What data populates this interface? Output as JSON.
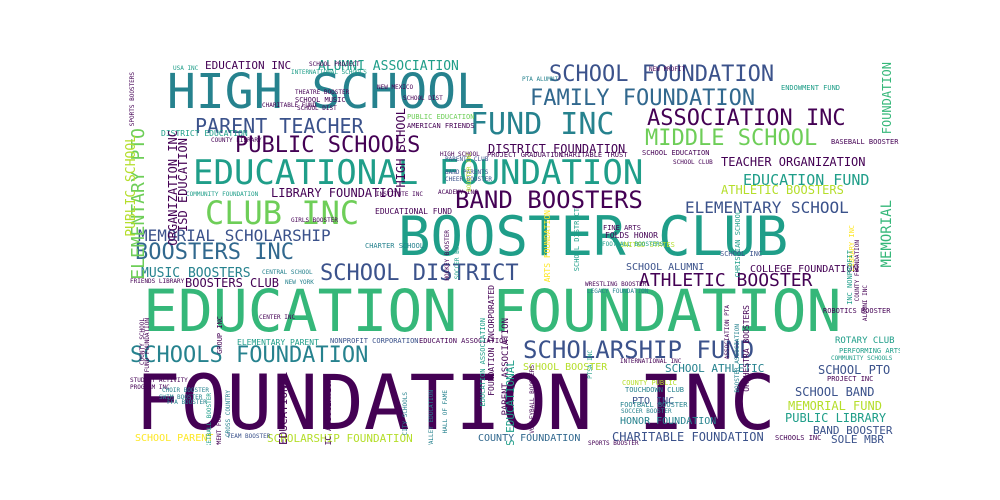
{
  "palette": {
    "dark_purple": "#440154",
    "indigo": "#3b528b",
    "slate_blue": "#31688e",
    "teal_blue": "#26828e",
    "teal": "#1f9e89",
    "green": "#35b779",
    "light_green": "#6ece58",
    "yellow_green": "#b5de2b",
    "yellow": "#fde725"
  },
  "words": {
    "foundation_inc": "FOUNDATION INC",
    "education_foundation": "EDUCATION FOUNDATION",
    "booster_club": "BOOSTER CLUB",
    "high_school": "HIGH SCHOOL",
    "educational_foundation": "EDUCATIONAL FOUNDATION",
    "school_foundation": "SCHOOL FOUNDATION",
    "family_foundation": "FAMILY FOUNDATION",
    "fund_inc": "FUND INC",
    "association_inc": "ASSOCIATION INC",
    "middle_school": "MIDDLE SCHOOL",
    "parent_teacher": "PARENT TEACHER",
    "public_schools": "PUBLIC SCHOOLS",
    "club_inc": "CLUB INC",
    "band_boosters": "BAND BOOSTERS",
    "elementary_school": "ELEMENTARY SCHOOL",
    "memorial_scholarship": "MEMORIAL SCHOLARSHIP",
    "boosters_inc": "BOOSTERS INC",
    "school_district": "SCHOOL DISTRICT",
    "athletic_booster": "ATHLETIC BOOSTER",
    "schools_foundation": "SCHOOLS FOUNDATION",
    "scholarship_fund": "SCHOLARSHIP FUND",
    "education_fund": "EDUCATION FUND",
    "alumni_association": "ALUMNI ASSOCIATION",
    "education_inc": "EDUCATION INC",
    "teacher_organization": "TEACHER ORGANIZATION",
    "athletic_boosters": "ATHLETIC BOOSTERS",
    "library_foundation": "LIBRARY FOUNDATION",
    "district_foundation": "DISTRICT FOUNDATION",
    "music_boosters": "MUSIC BOOSTERS",
    "boosters_club": "BOOSTERS CLUB",
    "school_alumni": "SCHOOL ALUMNI",
    "college_foundation": "COLLEGE FOUNDATION",
    "school_booster": "SCHOOL BOOSTER",
    "school_athletic": "SCHOOL ATHLETIC",
    "school_pto": "SCHOOL PTO",
    "school_band": "SCHOOL BAND",
    "memorial_fund": "MEMORIAL FUND",
    "public_library": "PUBLIC LIBRARY",
    "band_booster": "BAND BOOSTER",
    "sole_mbr": "SOLE MBR",
    "charitable_foundation": "CHARITABLE FOUNDATION",
    "county_foundation": "COUNTY FOUNDATION",
    "scholarship_foundation": "SCHOLARSHIP FOUNDATION",
    "school_parent": "SCHOOL PARENT",
    "pto_inc": "PTO INC",
    "honor_foundation": "HONOR FOUNDATION",
    "nonprofit_corporation": "NONPROFIT CORPORATION",
    "education_association": "EDUCATION ASSOCIATION",
    "elementary_parent": "ELEMENTARY PARENT",
    "educational_fund": "EDUCATIONAL FUND",
    "charter_school": "CHARTER SCHOOL",
    "central_school": "CENTRAL SCHOOL",
    "school_inc": "SCHOOL INC",
    "county_library": "COUNTY LIBRARY",
    "community_foundation": "COMMUNITY FOUNDATION",
    "district_education": "DISTRICT EDUCATION",
    "project_graduation": "PROJECT GRADUATION",
    "charitable_trust": "CHARITABLE TRUST",
    "american_friends": "AMERICAN FRIENDS",
    "public_education": "PUBLIC EDUCATION",
    "school_music": "SCHOOL MUSIC",
    "school_education": "SCHOOL EDUCATION",
    "endowment_fund": "ENDOWMENT FUND",
    "baseball_booster": "BASEBALL BOOSTER",
    "folds_honor": "FOLDS HONOR",
    "united_states": "UNITED STATES",
    "football_boosters": "FOOTBALL BOOSTERS",
    "wrestling_booster": "WRESTLING BOOSTER",
    "legacy_foundation": "LEGACY FOUNDATION",
    "rotary_club": "ROTARY CLUB",
    "performing_arts": "PERFORMING ARTS",
    "community_schools": "COMMUNITY SCHOOLS",
    "project_inc": "PROJECT INC",
    "robotics_booster": "ROBOTICS BOOSTER",
    "international_inc": "INTERNATIONAL INC",
    "county_public": "COUNTY PUBLIC",
    "touchdown_club": "TOUCHDOWN CLUB",
    "football_booster": "FOOTBALL BOOSTER",
    "soccer_booster": "SOCCER BOOSTER",
    "schools_inc": "SCHOOLS INC",
    "team_booster": "TEAM BOOSTER",
    "sports_booster": "SPORTS BOOSTER",
    "parents_club": "PARENTS CLUB",
    "band_parents": "BAND PARENTS",
    "cheer_booster": "CHEER BOOSTER",
    "new_mexico": "NEW MEXICO",
    "pta_alumni": "PTA ALUMNI",
    "new_profit": "NEW PROFIT",
    "academy_inc": "ACADEMY INC",
    "high_school_2": "HIGH SCHOOL",
    "program_inc": "PROGRAM INC",
    "student_activity": "STUDENT ACTIVITY",
    "new_york": "NEW YORK",
    "usa_inc": "USA INC",
    "school_project": "SCHOOL PROJECT",
    "theatre_booster": "THEATRE BOOSTER",
    "international_schools": "INTERNATIONAL SCHOOLS",
    "elementary_pto": "ELEMENTARY PTO",
    "organization_inc": "ORGANIZATION INC",
    "isd_education": "ISD EDUCATION",
    "public_school": "PUBLIC SCHOOL",
    "high_school_vertical": "HIGH SCHOOL",
    "christian_school": "CHRISTIAN SCHOOL",
    "orchestra_boosters": "ORCHESTRA BOOSTERS",
    "parent_association": "PARENT ASSOCIATION",
    "foundation_incorporated": "FOUNDATION INCORPORATED",
    "schools_educational": "SCHOOLS EDUCATIONAL",
    "district_educational": "DISTRICT EDUCATIONAL",
    "athletic_association": "ATHLETIC ASSOCIATION",
    "foundation_vertical": "FOUNDATION",
    "memorial_vertical": "MEMORIAL",
    "sports_boosters": "SPORTS BOOSTERS",
    "arts_foundation": "ARTS FOUNDATION",
    "booster_association": "BOOSTER ASSOCIATION",
    "education_association_2": "EDUCATION ASSOCIATION",
    "ptsa_inc": "PTSA INC",
    "library_inc": "LIBRARY INC",
    "fine_arts": "FINE ARTS",
    "alumni_inc": "ALUMNI INC",
    "county_foundation_2": "COUNTY FOUNDATION",
    "volleyball_boosters": "VOLLEYBALL BOOSTERS",
    "school_district_2": "SCHOOL DISTRICT",
    "inc_nonprofit": "INC NONPROFIT",
    "hockey_booster": "HOCKEY BOOSTER",
    "soccer_boosters": "SOCCER BOOSTERS",
    "association_pta": "ASSOCIATION PTA",
    "booster_inc": "BOOSTER INC",
    "group_inc": "GROUP INC",
    "center_inc": "CENTER INC",
    "fund_foundation": "FUND FOUNDATION",
    "county_school": "COUNTY SCHOOL",
    "girls_booster": "GIRLS BOOSTER",
    "ffa_booster": "FFA BOOSTER",
    "school_dist": "SCHOOL DIST",
    "cross_country": "CROSS COUNTRY",
    "basketball_booster": "BASKETBALL BOOSTER",
    "city_schools": "CITY SCHOOLS",
    "valley_education": "VALLEY EDUCATION",
    "hall_of_fame": "HALL OF FAME",
    "school_club": "SCHOOL CLUB",
    "friends_library": "FRIENDS LIBRARY",
    "swim_booster": "SWIM BOOSTER",
    "choir_booster": "CHOIR BOOSTER",
    "charitable_fund": "CHARITABLE FUND",
    "development_foundation": "DEVELOPMENT FOUNDATION",
    "institute_inc": "INSTITUTE INC",
    "school_dist_2": "SCHOOL DIST"
  }
}
